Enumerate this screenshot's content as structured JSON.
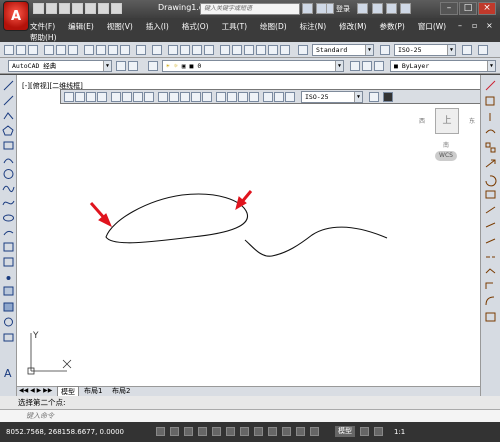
{
  "window": {
    "title": "Drawing1.dwg",
    "search_placeholder": "键入关键字或短语",
    "login_label": "登录"
  },
  "menus": {
    "row1": [
      "文件(F)",
      "编辑(E)",
      "视图(V)",
      "插入(I)",
      "格式(O)",
      "工具(T)",
      "绘图(D)",
      "标注(N)",
      "修改(M)",
      "参数(P)",
      "窗口(W)"
    ],
    "row2": [
      "帮助(H)"
    ]
  },
  "toolbar": {
    "text_style": "Standard",
    "dim_style": "ISO-25",
    "workspace": "AutoCAD 经典",
    "layer": "0",
    "color": "ByLayer"
  },
  "viewport": {
    "label": "[-][俯视][二维线框]",
    "float_dim_style": "ISO-25"
  },
  "viewcube": {
    "top_face": "上",
    "west": "西",
    "east": "东",
    "south": "南",
    "wcs": "WCS"
  },
  "ucs": {
    "x_label": "X",
    "y_label": "Y"
  },
  "tabs": [
    "模型",
    "布局1",
    "布局2"
  ],
  "command": {
    "history": "选择第二个点:",
    "prompt": "键入命令"
  },
  "status": {
    "coords": "8052.7568, 268158.6677, 0.0000",
    "model_label": "模型",
    "scale": "1:1"
  },
  "colors": {
    "annotation_arrow": "#e0141e",
    "app_button": "#d02518",
    "dark_chrome": "#3b3b3b"
  },
  "icons": [
    "app-menu-icon",
    "new-icon",
    "open-icon",
    "save-icon",
    "undo-icon",
    "redo-icon",
    "line-icon",
    "circle-icon",
    "arc-icon",
    "text-icon"
  ]
}
